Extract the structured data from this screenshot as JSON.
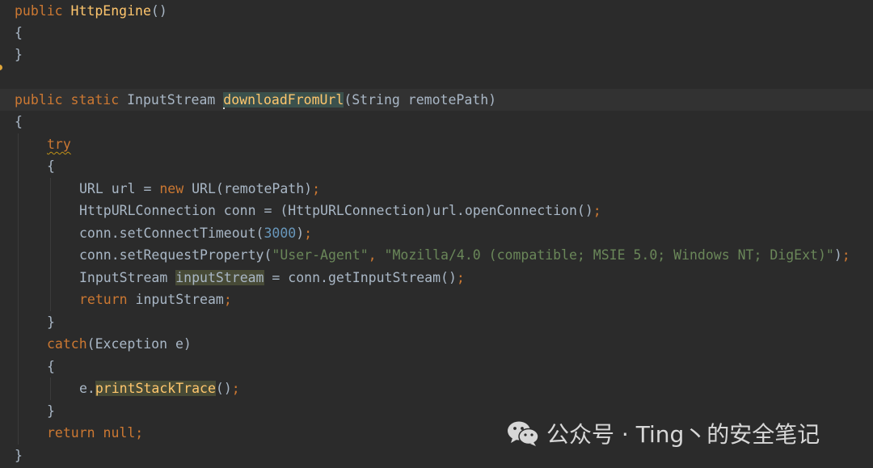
{
  "editor": {
    "language": "java",
    "lines": {
      "l1": [
        "public ",
        "HttpEngine",
        "()"
      ],
      "l2": [
        "{"
      ],
      "l3": [
        "}"
      ],
      "l4": [
        "public static ",
        "InputStream ",
        "downloadFromUrl",
        "(String remotePath)"
      ],
      "l5": [
        "{"
      ],
      "l6": [
        "try"
      ],
      "l7": [
        "{"
      ],
      "l8": [
        "URL url = ",
        "new ",
        "URL(remotePath)",
        ";"
      ],
      "l9": [
        "HttpURLConnection conn = (HttpURLConnection)url.openConnection()",
        ";"
      ],
      "l10": [
        "conn.setConnectTimeout(",
        "3000",
        ")",
        ";"
      ],
      "l11": [
        "conn.setRequestProperty(",
        "\"User-Agent\"",
        ", ",
        "\"Mozilla/4.0 (compatible; MSIE 5.0; Windows NT; DigExt)\"",
        ")",
        ";"
      ],
      "l12": [
        "InputStream ",
        "inputStream",
        " = conn.getInputStream()",
        ";"
      ],
      "l13": [
        "return ",
        "inputStream",
        ";"
      ],
      "l14": [
        "}"
      ],
      "l15": [
        "catch",
        "(Exception e)"
      ],
      "l16": [
        "{"
      ],
      "l17": [
        "e.",
        "printStackTrace",
        "()",
        ";"
      ],
      "l18": [
        "}"
      ],
      "l19": [
        "return null",
        ";"
      ],
      "l20": [
        "}"
      ]
    },
    "colors": {
      "background": "#2b2b2b",
      "keyword": "#cc7832",
      "function": "#ffc66d",
      "number": "#6897bb",
      "string": "#6a8759",
      "text": "#a9b7c6"
    }
  },
  "watermark": {
    "icon": "wechat-icon",
    "text": "公众号 · Ting丶的安全笔记"
  }
}
